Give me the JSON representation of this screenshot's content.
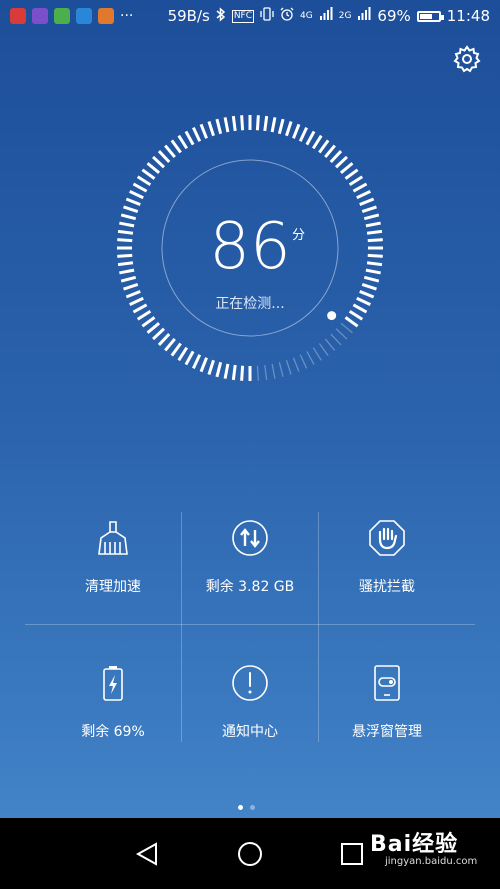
{
  "status_bar": {
    "speed": "59B/s",
    "nfc": "NFC",
    "network_1": "4G",
    "network_2": "2G",
    "battery": "69%",
    "battery_level": 0.69,
    "time": "11:48",
    "app_icon_colors": [
      "#d93a3a",
      "#7b4fc9",
      "#4cae4c",
      "#2a86d6",
      "#e0782d"
    ]
  },
  "score": {
    "value": "86",
    "unit": "分",
    "status": "正在检测...",
    "progress": 0.86
  },
  "tiles": [
    {
      "label": "清理加速",
      "icon": "broom-icon"
    },
    {
      "label": "剩余 3.82 GB",
      "icon": "data-transfer-icon"
    },
    {
      "label": "骚扰拦截",
      "icon": "hand-block-icon"
    },
    {
      "label": "剩余 69%",
      "icon": "battery-charging-icon"
    },
    {
      "label": "通知中心",
      "icon": "alert-icon"
    },
    {
      "label": "悬浮窗管理",
      "icon": "floating-window-icon"
    }
  ],
  "pager": {
    "pages": 2,
    "current": 1
  },
  "watermark": {
    "brand": "Bai经验",
    "url": "jingyan.baidu.com"
  },
  "colors": {
    "accent": "#ffffff",
    "background_top": "#1d4e99",
    "background_bottom": "#4383c7"
  }
}
